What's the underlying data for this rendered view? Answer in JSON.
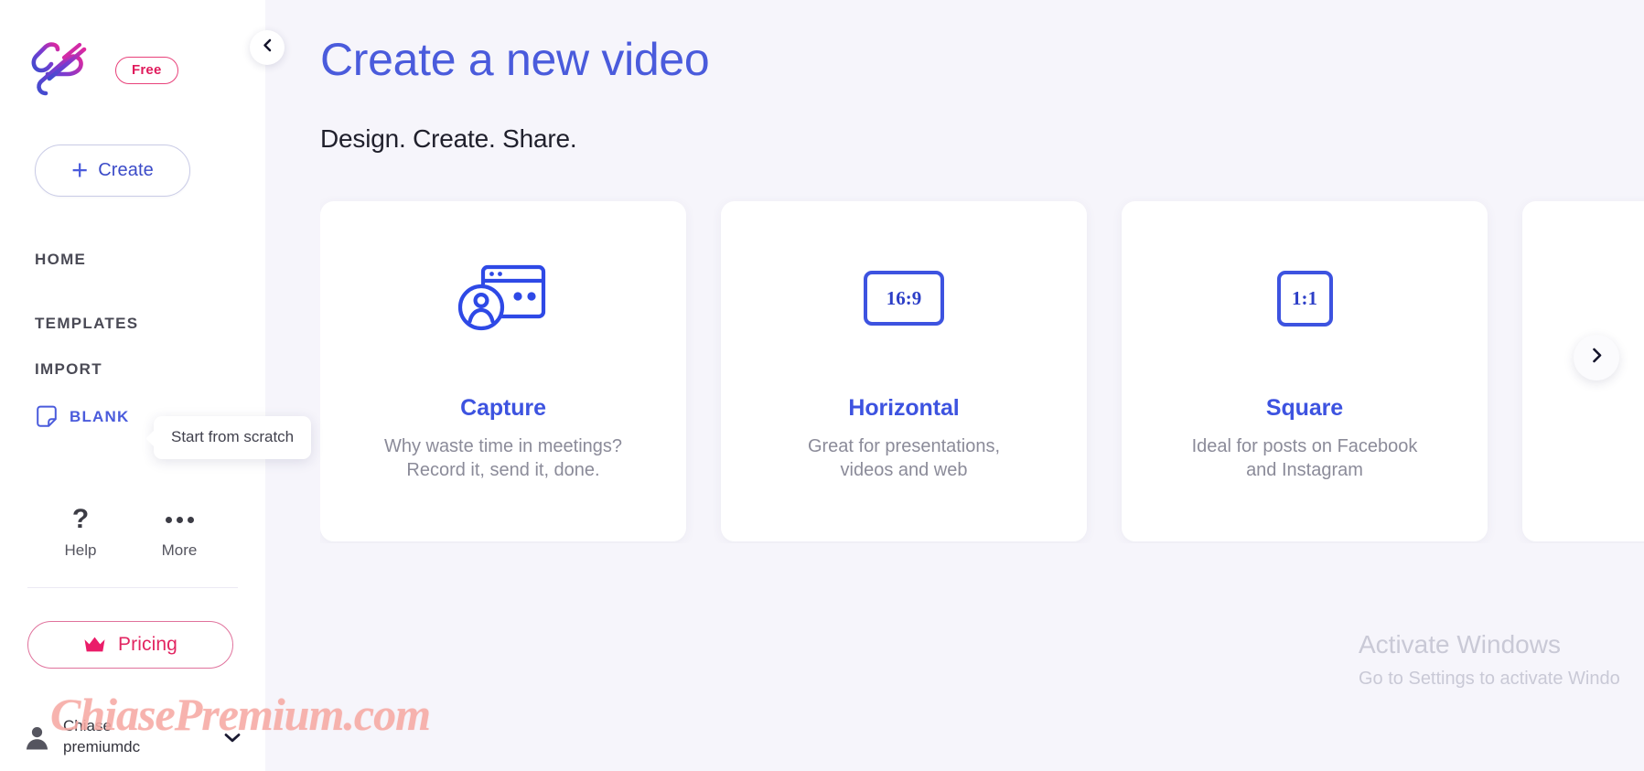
{
  "sidebar": {
    "logo_name": "vimeo-create-paperclip-logo",
    "plan_badge": "Free",
    "create_button": "Create",
    "create_plus": "+",
    "nav_items": [
      {
        "label": "HOME"
      },
      {
        "label": "TEMPLATES"
      },
      {
        "label": "IMPORT"
      },
      {
        "label": "BLANK"
      }
    ],
    "tooltip": "Start from scratch",
    "helpers": [
      {
        "label": "Help",
        "glyph": "?"
      },
      {
        "label": "More",
        "glyph": "•••"
      }
    ],
    "pricing_button": "Pricing",
    "account": {
      "line1": "Chiase",
      "line2": "premiumdc"
    }
  },
  "watermark": "ChiasePremium.com",
  "main": {
    "title": "Create a new video",
    "subtitle": "Design. Create. Share.",
    "cards": [
      {
        "id": "capture",
        "icon": "screen-capture-person-icon",
        "title": "Capture",
        "desc_line1": "Why waste time in meetings?",
        "desc_line2": "Record it, send it, done."
      },
      {
        "id": "horizontal",
        "icon": "aspect-16-9-icon",
        "ratio": "16:9",
        "title": "Horizontal",
        "desc_line1": "Great for presentations,",
        "desc_line2": "videos and web"
      },
      {
        "id": "square",
        "icon": "aspect-1-1-icon",
        "ratio": "1:1",
        "title": "Square",
        "desc_line1": "Ideal for posts on Facebook",
        "desc_line2": "and Instagram"
      },
      {
        "id": "partial",
        "icon": "",
        "ratio": "",
        "title": "",
        "desc_line1": "",
        "desc_line2": ""
      }
    ]
  },
  "windows_watermark": {
    "title": "Activate Windows",
    "subtitle": "Go to Settings to activate Windo"
  },
  "colors": {
    "accent_blue": "#3d53e0",
    "title_blue": "#4a5bdc",
    "pink": "#e22561",
    "bg": "#f6f5fb",
    "card_bg": "#ffffff",
    "muted_text": "#8b8b99",
    "watermark_pink": "#f6a9a3"
  }
}
